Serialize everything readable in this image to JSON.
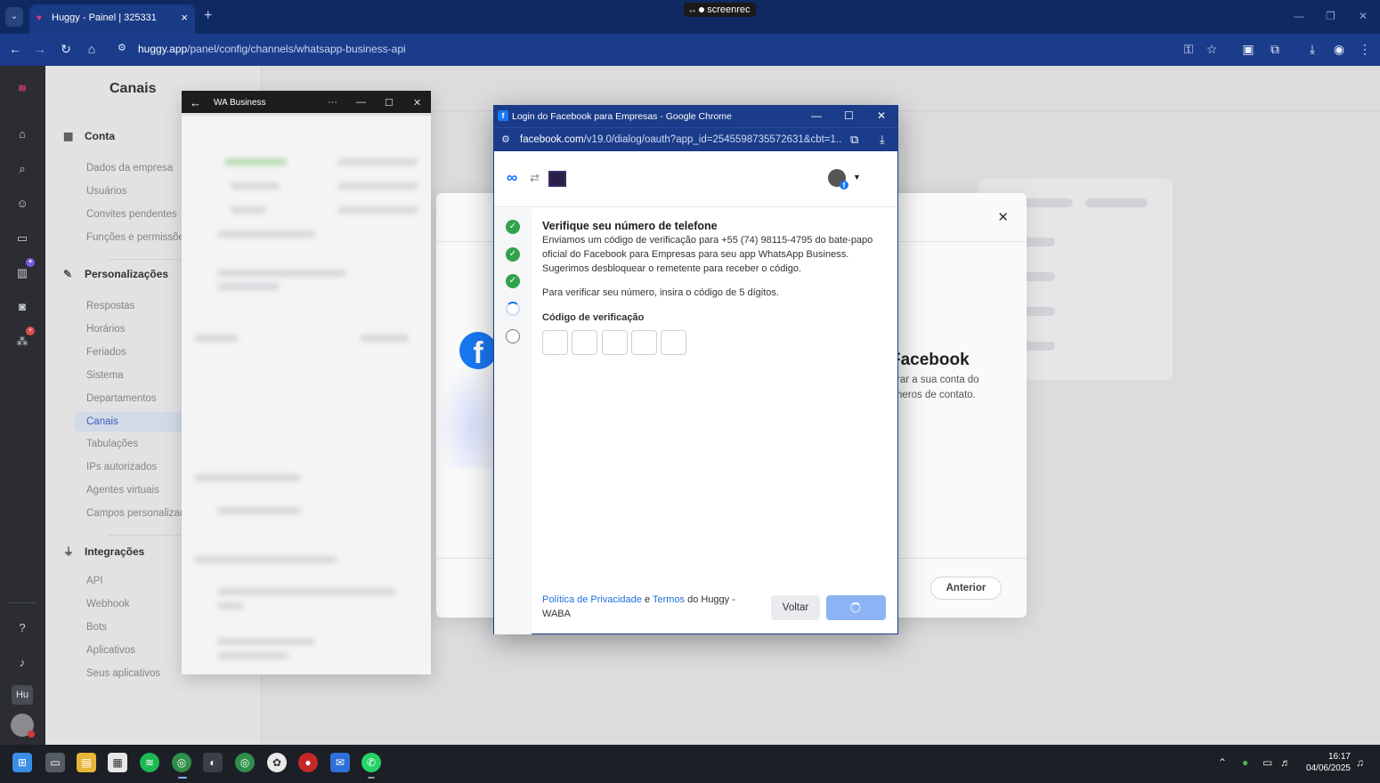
{
  "browser": {
    "tab_title": "Huggy - Painel | 325331",
    "tab_close": "×",
    "new_tab": "+",
    "address_host": "huggy.app",
    "address_path": "/panel/config/channels/whatsapp-business-api",
    "recorder": "screenrec"
  },
  "page": {
    "title": "Canais"
  },
  "sidebar": {
    "sections": [
      {
        "title": "Conta",
        "icon": "building-icon",
        "items": [
          "Dados da empresa",
          "Usuários",
          "Convites pendentes",
          "Funções e permissões"
        ]
      },
      {
        "title": "Personalizações",
        "icon": "pencil-icon",
        "items": [
          "Respostas",
          "Horários",
          "Feriados",
          "Sistema",
          "Departamentos",
          "Canais",
          "Tabulações",
          "IPs autorizados",
          "Agentes virtuais",
          "Campos personalizados"
        ]
      },
      {
        "title": "Integrações",
        "icon": "plug-icon",
        "items": [
          "API",
          "Webhook",
          "Bots",
          "Aplicativos",
          "Seus aplicativos"
        ]
      }
    ],
    "active_item": "Canais"
  },
  "rail": {
    "user_initials": "Hu"
  },
  "huggy_modal": {
    "close": "✕",
    "fb_title": "Facebook",
    "fb_text": "rar a sua conta do\nneros de contato.",
    "prev_button": "Anterior"
  },
  "wa_window": {
    "title": "WA Business",
    "more": "···"
  },
  "fb_window": {
    "title": "Login do Facebook para Empresas - Google Chrome",
    "url_host": "facebook.com",
    "url_path": "/v19.0/dialog/oauth?app_id=2545598735572631&cbt=1...",
    "heading": "Verifique seu número de telefone",
    "paragraph": "Enviamos um código de verificação para +55 (74) 98115-4795 do bate-papo oficial do Facebook para Empresas para seu app WhatsApp Business. Sugerimos desbloquear o remetente para receber o código.",
    "instruction": "Para verificar seu número, insira o código de 5 dígitos.",
    "code_label": "Código de verificação",
    "code_digits": 5,
    "steps": [
      "done",
      "done",
      "done",
      "loading",
      "todo"
    ],
    "footer": {
      "privacy": "Política de Privacidade",
      "and": "e",
      "terms": "Termos",
      "suffix": "do Huggy - WABA"
    },
    "back_button": "Voltar"
  },
  "taskbar": {
    "time": "16:17",
    "date": "04/06/2025"
  },
  "colors": {
    "chrome_blue": "#1b3c8a",
    "facebook_blue": "#1877f2",
    "huggy_active": "#3b63c7",
    "step_done": "#31a24c"
  }
}
